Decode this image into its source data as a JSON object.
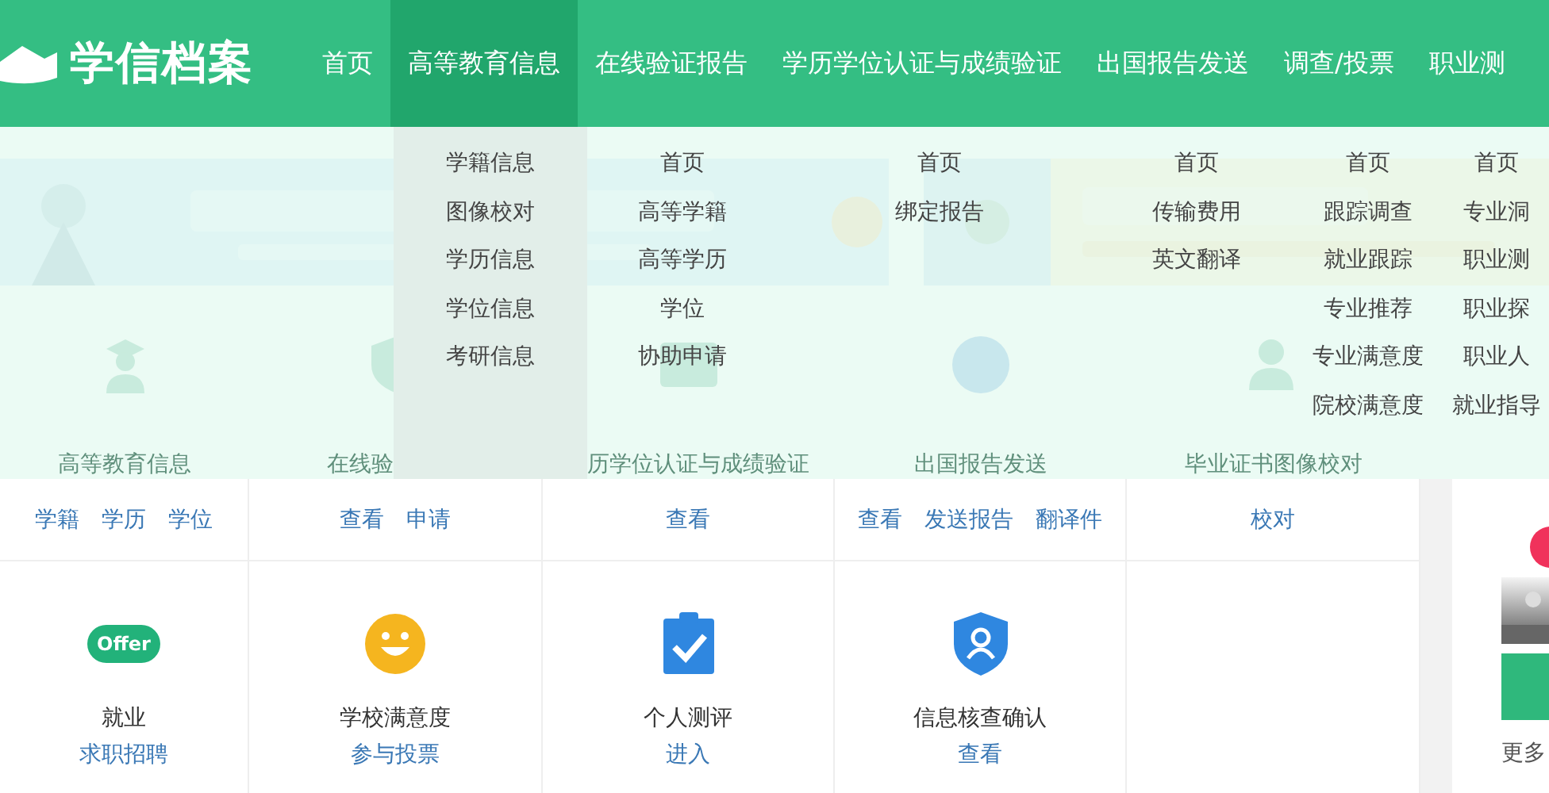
{
  "header": {
    "logo": "学信档案",
    "nav": [
      {
        "label": "首页",
        "selected": false
      },
      {
        "label": "高等教育信息",
        "selected": true
      },
      {
        "label": "在线验证报告",
        "selected": false
      },
      {
        "label": "学历学位认证与成绩验证",
        "selected": false
      },
      {
        "label": "出国报告发送",
        "selected": false
      },
      {
        "label": "调查/投票",
        "selected": false
      },
      {
        "label": "职业测",
        "selected": false
      }
    ]
  },
  "dropdown": {
    "columns": [
      {
        "selected": true,
        "items": [
          "学籍信息",
          "图像校对",
          "学历信息",
          "学位信息",
          "考研信息"
        ]
      },
      {
        "selected": false,
        "items": [
          "首页",
          "高等学籍",
          "高等学历",
          "学位",
          "协助申请"
        ]
      },
      {
        "selected": false,
        "items": [
          "首页",
          "绑定报告"
        ]
      },
      {
        "selected": false,
        "items": [
          "首页",
          "传输费用",
          "英文翻译"
        ]
      },
      {
        "selected": false,
        "items": [
          "首页",
          "跟踪调查",
          "就业跟踪",
          "专业推荐",
          "专业满意度",
          "院校满意度"
        ]
      },
      {
        "selected": false,
        "items": [
          "首页",
          "专业洞",
          "职业测",
          "职业探",
          "职业人",
          "就业指导"
        ]
      }
    ]
  },
  "services": [
    {
      "label": "高等教育信息"
    },
    {
      "label": "在线验"
    },
    {
      "label": "历学位认证与成绩验证"
    },
    {
      "label": "出国报告发送"
    },
    {
      "label": "毕业证书图像校对"
    }
  ],
  "links": [
    [
      "学籍",
      "学历",
      "学位"
    ],
    [
      "查看",
      "申请"
    ],
    [
      "查看"
    ],
    [
      "查看",
      "发送报告",
      "翻译件"
    ],
    [
      "校对"
    ]
  ],
  "cards": [
    {
      "kind": "offer",
      "badge": "Offer",
      "title": "就业",
      "link": "求职招聘"
    },
    {
      "kind": "smile",
      "title": "学校满意度",
      "link": "参与投票"
    },
    {
      "kind": "clipboard",
      "title": "个人测评",
      "link": "进入"
    },
    {
      "kind": "shield",
      "title": "信息核查确认",
      "link": "查看"
    }
  ],
  "sidebar": {
    "more": "更多"
  }
}
